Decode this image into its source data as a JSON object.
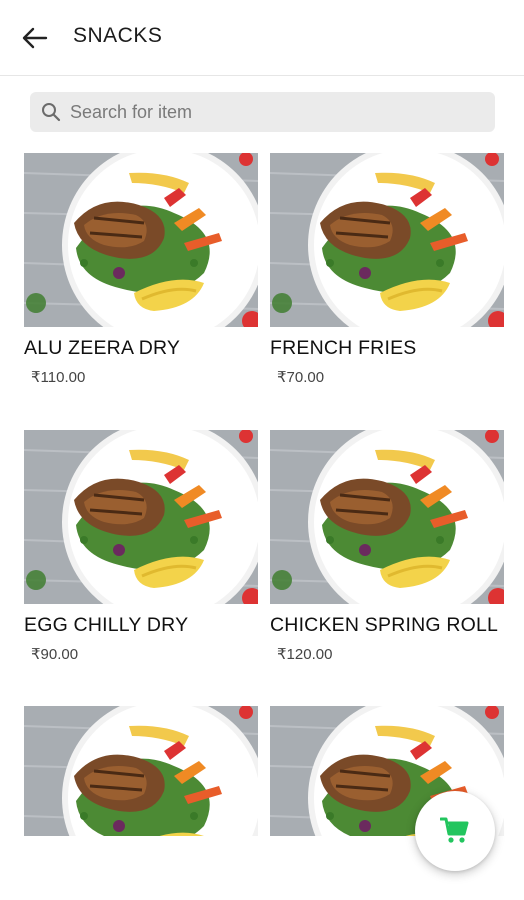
{
  "header": {
    "title": "SNACKS",
    "back_icon": "arrow-left-icon"
  },
  "search": {
    "placeholder": "Search for item",
    "value": "",
    "icon": "search-icon"
  },
  "items": [
    {
      "name": "ALU ZEERA DRY",
      "price": "₹110.00"
    },
    {
      "name": "FRENCH FRIES",
      "price": "₹70.00"
    },
    {
      "name": "EGG CHILLY DRY",
      "price": "₹90.00"
    },
    {
      "name": "CHICKEN SPRING ROLL",
      "price": "₹120.00"
    },
    {
      "name": "",
      "price": ""
    },
    {
      "name": "",
      "price": ""
    }
  ],
  "cart_fab": {
    "icon": "cart-icon",
    "color": "#22c55e"
  }
}
